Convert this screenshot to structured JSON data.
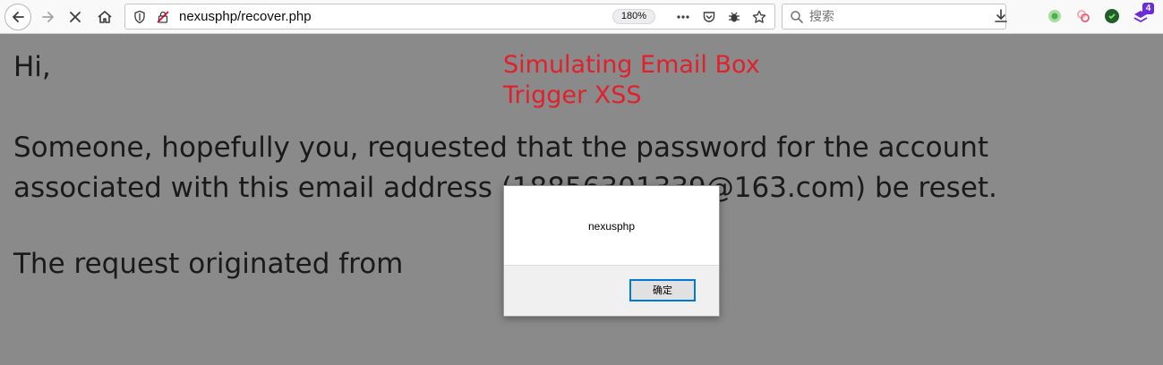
{
  "browser": {
    "url": "nexusphp/recover.php",
    "zoom": "180%",
    "search_placeholder": "搜索",
    "extension_badge": "4"
  },
  "page": {
    "greeting": "Hi,",
    "overlay_line1": "Simulating Email Box",
    "overlay_line2": "Trigger XSS",
    "paragraph1": "Someone, hopefully you, requested that the password for the account associated with this email address (18856301339@163.com) be reset.",
    "paragraph2": "The request originated from"
  },
  "dialog": {
    "message": "nexusphp",
    "ok_label": "确定"
  },
  "colors": {
    "overlay_text": "#e0212c",
    "dimmed_background": "#8a8a8a",
    "dialog_button_border": "#0078d7"
  }
}
